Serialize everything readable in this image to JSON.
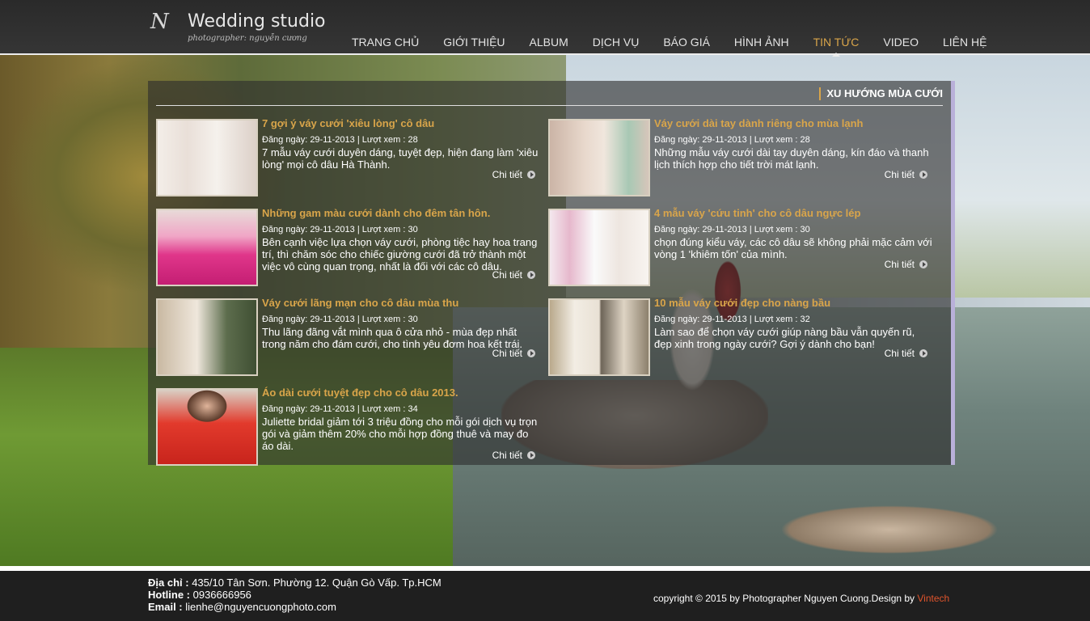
{
  "logo": {
    "mark": "N",
    "title": "Wedding studio",
    "subtitle": "photographer: nguyễn cương"
  },
  "nav": [
    {
      "label": "TRANG CHỦ"
    },
    {
      "label": "GIỚI THIỆU"
    },
    {
      "label": "ALBUM"
    },
    {
      "label": "DỊCH VỤ"
    },
    {
      "label": "BÁO GIÁ"
    },
    {
      "label": "HÌNH ẢNH"
    },
    {
      "label": "TIN TỨC",
      "active": true
    },
    {
      "label": "VIDEO"
    },
    {
      "label": "LIÊN HỆ"
    }
  ],
  "section_title": "XU HƯỚNG MÙA CƯỚI",
  "more_label": "Chi tiết",
  "news": [
    {
      "title": "7 gợi ý váy cưới 'xiêu lòng' cô dâu",
      "meta": "Đăng ngày: 29-11-2013 | Lượt xem : 28",
      "desc": "7 mẫu váy cưới duyên dáng, tuyệt đẹp, hiện đang làm 'xiêu lòng' mọi cô dâu Hà Thành."
    },
    {
      "title": "Váy cưới dài tay dành riêng cho mùa lạnh",
      "meta": "Đăng ngày: 29-11-2013 | Lượt xem : 28",
      "desc": "Những mẫu váy cưới dài tay duyên dáng, kín đáo và thanh lịch thích hợp cho tiết trời mát lạnh."
    },
    {
      "title": "Những gam màu cưới dành cho đêm tân hôn.",
      "meta": "Đăng ngày: 29-11-2013 | Lượt xem : 30",
      "desc": "Bên cạnh việc lựa chọn váy cưới, phòng tiệc hay hoa trang trí, thì chăm sóc cho chiếc giường cưới đã trở thành một việc vô cùng quan trọng, nhất là đối với các cô dâu."
    },
    {
      "title": "4 mẫu váy 'cứu tinh' cho cô dâu ngực lép",
      "meta": "Đăng ngày: 29-11-2013 | Lượt xem : 30",
      "desc": "chọn đúng kiểu váy, các cô dâu sẽ không phải mặc cảm với vòng 1 'khiêm tốn' của mình."
    },
    {
      "title": "Váy cưới lãng mạn cho cô dâu mùa thu",
      "meta": "Đăng ngày: 29-11-2013 | Lượt xem : 30",
      "desc": "Thu lãng đãng vắt mình qua ô cửa nhỏ - mùa đẹp nhất trong năm cho đám cưới, cho tình yêu đơm hoa kết trái."
    },
    {
      "title": "10 mẫu váy cưới đẹp cho nàng bầu",
      "meta": "Đăng ngày: 29-11-2013 | Lượt xem : 32",
      "desc": "Làm sao để chọn váy cưới giúp nàng bầu vẫn quyến rũ, đẹp xinh trong ngày cưới? Gợi ý dành cho bạn!"
    },
    {
      "title": "Áo dài cưới tuyệt đẹp cho cô dâu 2013.",
      "meta": "Đăng ngày: 29-11-2013 | Lượt xem : 34",
      "desc": "Juliette bridal giảm tới 3 triệu đồng cho mỗi gói dịch vụ trọn gói và giảm thêm 20% cho mỗi hợp đồng thuê và may đo áo dài."
    }
  ],
  "footer": {
    "address_label": "Địa chỉ :",
    "address": " 435/10 Tân Sơn. Phường 12. Quận Gò Vấp. Tp.HCM",
    "hotline_label": "Hotline :",
    "hotline": " 0936666956",
    "email_label": "Email :",
    "email": " lienhe@nguyencuongphoto.com",
    "copyright": "copyright © 2015 by Photographer Nguyen Cuong.Design by ",
    "designer": "Vintech"
  },
  "colors": {
    "accent": "#d9a54a",
    "header_bg": "#2f2f2f",
    "footer_bg": "#1f1f1f",
    "brand": "#e0542c"
  }
}
